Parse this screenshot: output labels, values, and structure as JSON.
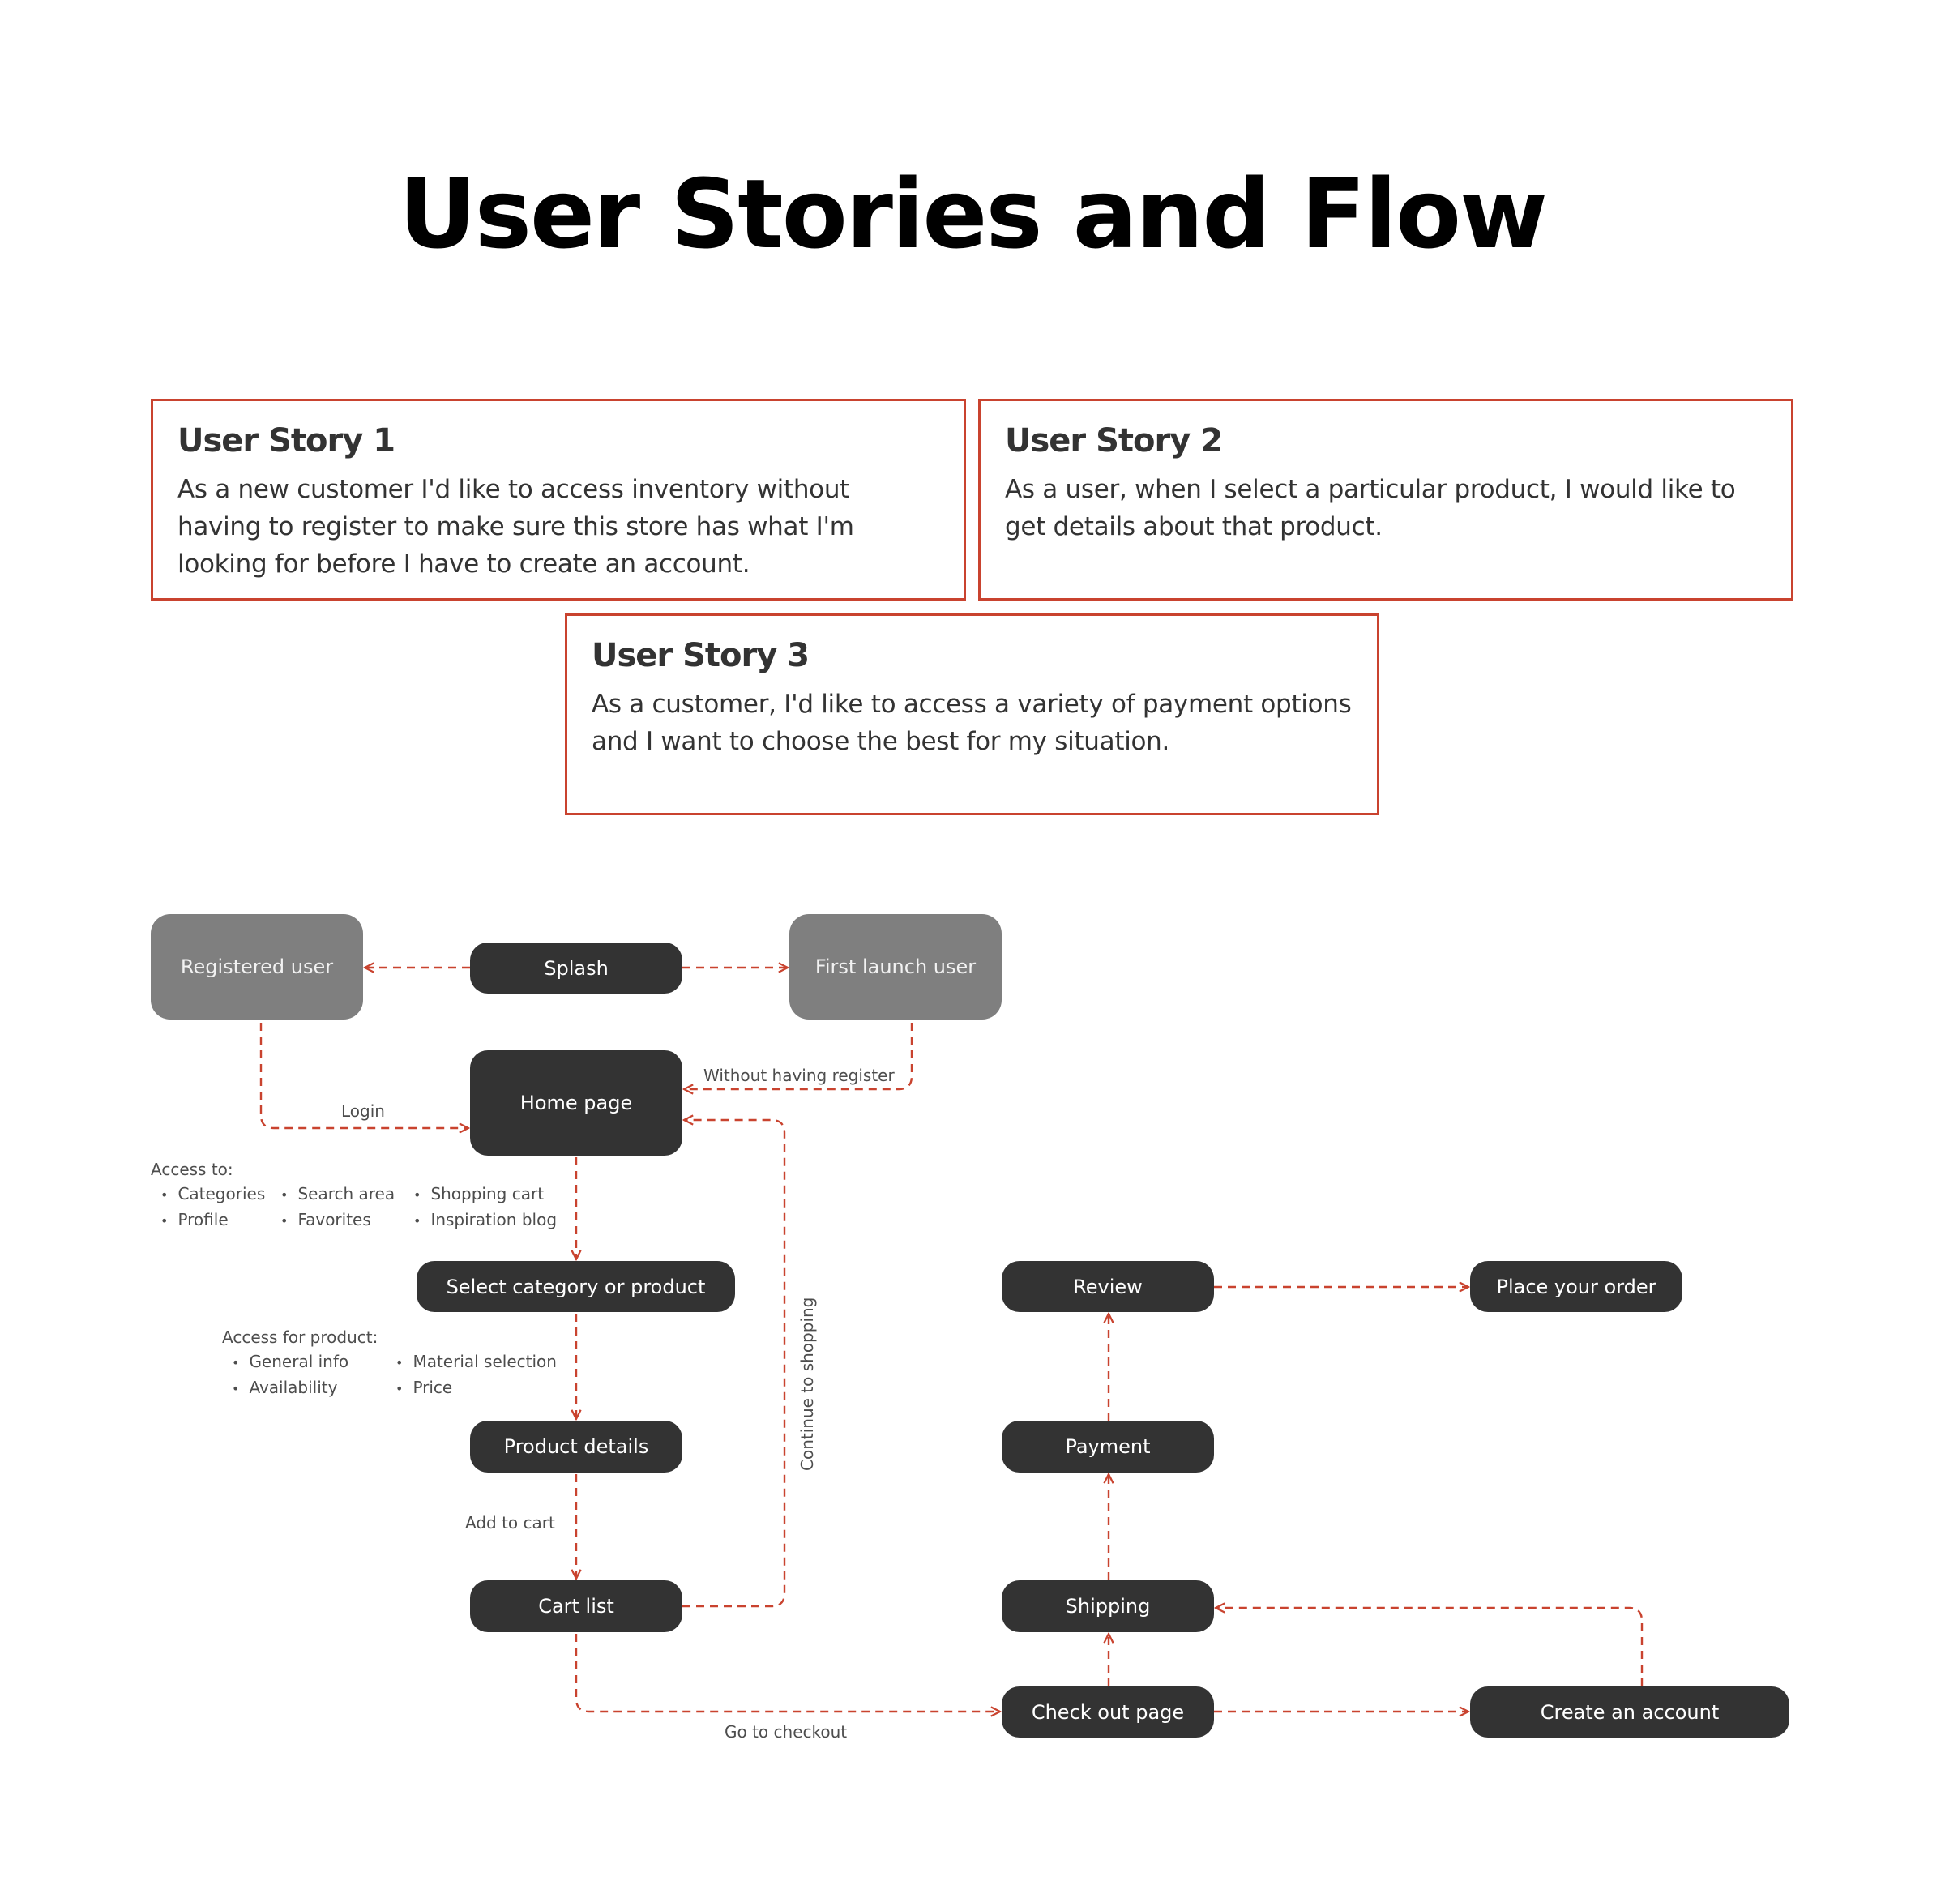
{
  "title": "User Stories and Flow",
  "accent_color": "#c9432f",
  "stories": [
    {
      "heading": "User Story 1",
      "text": "As a new customer I'd like to access inventory without having to register to make sure this store has what I'm looking for before I have to create an account."
    },
    {
      "heading": "User Story 2",
      "text": "As a user, when I select a particular product, I would like to get details about that product."
    },
    {
      "heading": "User Story 3",
      "text": "As a customer, I'd like to access a variety of payment options and I want to choose the best for my situation."
    }
  ],
  "nodes": {
    "registered_user": "Registered user",
    "splash": "Splash",
    "first_launch_user": "First launch user",
    "home_page": "Home page",
    "select_category": "Select category or product",
    "product_details": "Product details",
    "cart_list": "Cart list",
    "review": "Review",
    "place_order": "Place your order",
    "payment": "Payment",
    "shipping": "Shipping",
    "checkout": "Check out page",
    "create_account": "Create an account"
  },
  "edge_labels": {
    "login": "Login",
    "without_register": "Without having register",
    "continue_shopping": "Continue to shopping",
    "add_to_cart": "Add to cart",
    "go_to_checkout": "Go to checkout"
  },
  "home_access": {
    "heading": "Access to:",
    "items": [
      "Categories",
      "Search area",
      "Shopping cart",
      "Profile",
      "Favorites",
      "Inspiration blog"
    ]
  },
  "product_access": {
    "heading": "Access for product:",
    "items": [
      "General info",
      "Material selection",
      "Availability",
      "Price"
    ]
  }
}
